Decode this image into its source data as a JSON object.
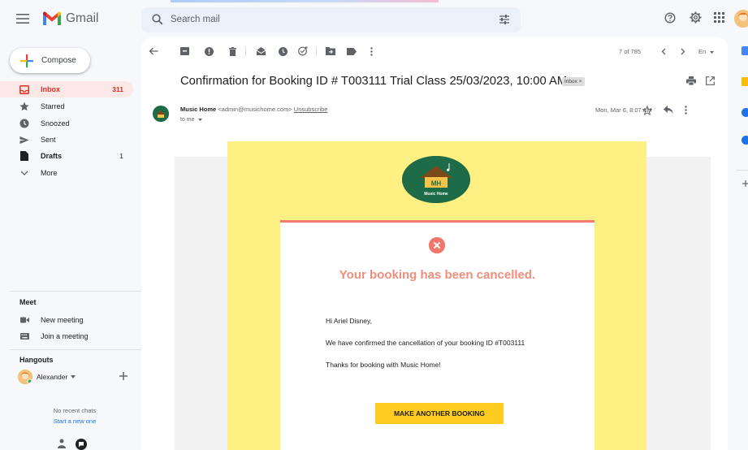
{
  "topbar": {
    "app_name": "Gmail",
    "search_placeholder": "Search mail"
  },
  "sidebar": {
    "compose_label": "Compose",
    "items": [
      {
        "label": "Inbox",
        "count": "311",
        "icon": "inbox-icon",
        "active": true
      },
      {
        "label": "Starred",
        "count": "",
        "icon": "star-icon"
      },
      {
        "label": "Snoozed",
        "count": "",
        "icon": "clock-icon"
      },
      {
        "label": "Sent",
        "count": "",
        "icon": "send-icon"
      },
      {
        "label": "Drafts",
        "count": "1",
        "icon": "draft-icon"
      },
      {
        "label": "More",
        "count": "",
        "icon": "chevron-down-icon"
      }
    ],
    "meet": {
      "heading": "Meet",
      "new_meeting": "New meeting",
      "join_meeting": "Join a meeting"
    },
    "hangouts": {
      "heading": "Hangouts",
      "user": "Alexander",
      "no_chats": "No recent chats",
      "start_new": "Start a new one"
    }
  },
  "toolbar": {
    "pager": "7 of 785",
    "lang": "En"
  },
  "email": {
    "subject": "Confirmation for Booking ID # T003111 Trial Class 25/03/2023, 10:00 AM",
    "label_chip": "Inbox ×",
    "sender_name": "Music Home",
    "sender_addr": "<admin@musichome.com>",
    "unsubscribe": "Unsubscribe",
    "to": "to me",
    "date": "Mon, Mar 6, 8:07 AM",
    "logo_initials": "MH",
    "logo_subtitle": "Music Home",
    "cancel_title": "Your booking has been cancelled.",
    "greeting": "Hi Ariel Disney,",
    "line1": "We have confirmed the cancellation of your booking ID #T003111",
    "line2": "Thanks for booking with Music Home!",
    "button": "MAKE ANOTHER BOOKING"
  },
  "colors": {
    "gmail_red": "#ea4335",
    "inbox_active_bg": "#fce8e6",
    "email_yellow": "#fef082",
    "cancel_coral": "#f08d7c",
    "button_yellow": "#fecc1e",
    "brand_green": "#1e6b47"
  }
}
